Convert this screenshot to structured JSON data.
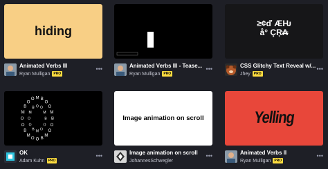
{
  "cards": [
    {
      "title": "Animated Verbs III",
      "author": "Ryan Mulligan",
      "badge": "PRO",
      "preview_text": "hiding",
      "more": "•••"
    },
    {
      "title": "Animated Verbs III - Tease...",
      "author": "Ryan Mulligan",
      "badge": "PRO",
      "more": "•••"
    },
    {
      "title": "CSS Glitchy Text Reveal w/...",
      "author": "Jhey",
      "badge": "PRO",
      "preview_line1": "≥¢ď ÆǶ",
      "preview_line2": "å° ÇŖ₳",
      "more": "•••"
    },
    {
      "title": "OK",
      "author": "Adam Kuhn",
      "badge": "PRO",
      "more": "•••"
    },
    {
      "title": "Image animation on scroll",
      "author": "JohannesSchwegler",
      "preview_text": "Image animation on scroll",
      "more": "•••"
    },
    {
      "title": "Animated Verbs II",
      "author": "Ryan Mulligan",
      "badge": "PRO",
      "preview_text": "Yelling",
      "more": "•••"
    }
  ],
  "colors": {
    "background": "#1e1f26",
    "pro_badge": "#ffdd40",
    "card1_bg": "#f8cf85",
    "card6_bg": "#e8473a"
  }
}
